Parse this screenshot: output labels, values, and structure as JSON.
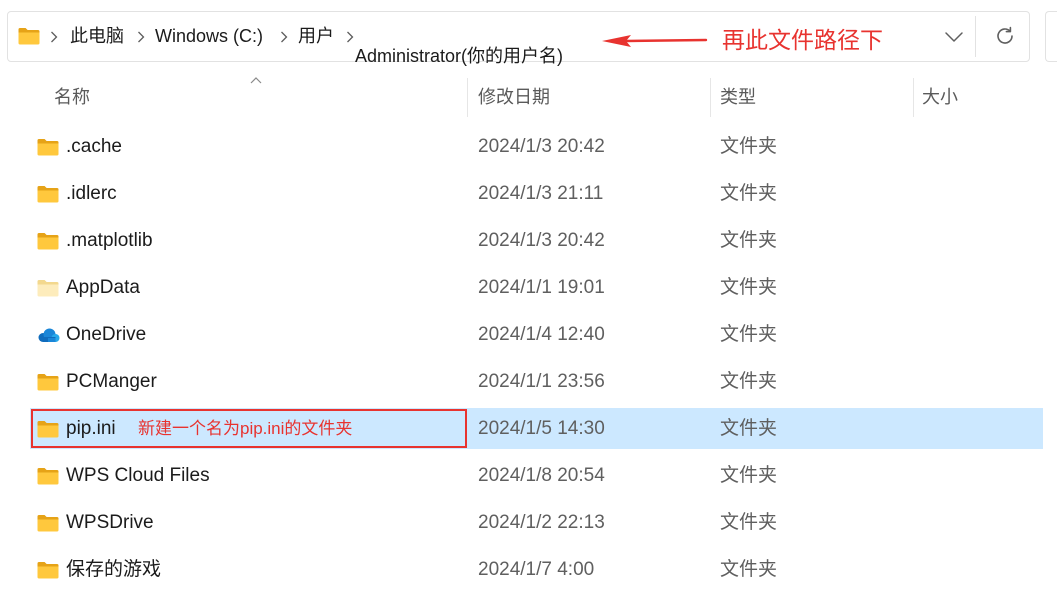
{
  "address_bar": {
    "location_icon": "folder-icon",
    "separator_icon": "chevron-right-icon",
    "breadcrumb": [
      "此电脑",
      "Windows (C:)",
      "用户"
    ],
    "current_folder": "Administrator(你的用户名)",
    "history_icon": "chevron-down-icon",
    "refresh_icon": "refresh-icon"
  },
  "path_annotation": {
    "text": "再此文件路径下",
    "arrow_icon": "arrow-left-icon"
  },
  "columns": {
    "name": "名称",
    "modified": "修改日期",
    "type": "类型",
    "size": "大小",
    "sort_icon": "sort-ascending-icon"
  },
  "rows": [
    {
      "name": ".cache",
      "modified": "2024/1/3 20:42",
      "type": "文件夹",
      "icon": "folder-icon"
    },
    {
      "name": ".idlerc",
      "modified": "2024/1/3 21:11",
      "type": "文件夹",
      "icon": "folder-icon"
    },
    {
      "name": ".matplotlib",
      "modified": "2024/1/3 20:42",
      "type": "文件夹",
      "icon": "folder-icon"
    },
    {
      "name": "AppData",
      "modified": "2024/1/1 19:01",
      "type": "文件夹",
      "icon": "hidden-folder-icon"
    },
    {
      "name": "OneDrive",
      "modified": "2024/1/4 12:40",
      "type": "文件夹",
      "icon": "onedrive-icon"
    },
    {
      "name": "PCManger",
      "modified": "2024/1/1 23:56",
      "type": "文件夹",
      "icon": "folder-icon"
    },
    {
      "name": "pip.ini",
      "modified": "2024/1/5 14:30",
      "type": "文件夹",
      "icon": "folder-icon",
      "selected": true,
      "annotation": "新建一个名为pip.ini的文件夹"
    },
    {
      "name": "WPS Cloud Files",
      "modified": "2024/1/8 20:54",
      "type": "文件夹",
      "icon": "folder-icon"
    },
    {
      "name": "WPSDrive",
      "modified": "2024/1/2 22:13",
      "type": "文件夹",
      "icon": "folder-icon"
    },
    {
      "name": "保存的游戏",
      "modified": "2024/1/7 4:00",
      "type": "文件夹",
      "icon": "folder-icon"
    }
  ],
  "colors": {
    "selection_background": "#cce8ff",
    "annotation_red": "#e8332f",
    "folder_yellow": "#ffc83d",
    "onedrive_blue": "#0f6cbd",
    "secondary_text": "#5f5f5f"
  }
}
